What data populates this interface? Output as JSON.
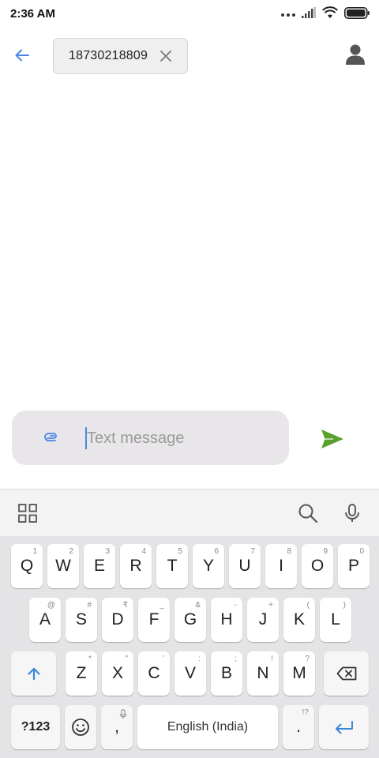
{
  "status_bar": {
    "time": "2:36 AM"
  },
  "header": {
    "recipient": "18730218809"
  },
  "compose": {
    "placeholder": "Text message"
  },
  "colors": {
    "accent": "#4a86e8",
    "send": "#5aa02c",
    "chip_bg": "#efefef",
    "compose_bg": "#e9e6ea",
    "keyboard_bg": "#e4e4e6"
  },
  "keyboard": {
    "row1": [
      {
        "label": "Q",
        "hint": "1"
      },
      {
        "label": "W",
        "hint": "2"
      },
      {
        "label": "E",
        "hint": "3"
      },
      {
        "label": "R",
        "hint": "4"
      },
      {
        "label": "T",
        "hint": "5"
      },
      {
        "label": "Y",
        "hint": "6"
      },
      {
        "label": "U",
        "hint": "7"
      },
      {
        "label": "I",
        "hint": "8"
      },
      {
        "label": "O",
        "hint": "9"
      },
      {
        "label": "P",
        "hint": "0"
      }
    ],
    "row2": [
      {
        "label": "A",
        "hint": "@"
      },
      {
        "label": "S",
        "hint": "#"
      },
      {
        "label": "D",
        "hint": "₹"
      },
      {
        "label": "F",
        "hint": "_"
      },
      {
        "label": "G",
        "hint": "&"
      },
      {
        "label": "H",
        "hint": "-"
      },
      {
        "label": "J",
        "hint": "+"
      },
      {
        "label": "K",
        "hint": "("
      },
      {
        "label": "L",
        "hint": ")"
      }
    ],
    "row3": [
      {
        "label": "Z",
        "hint": "*"
      },
      {
        "label": "X",
        "hint": "\""
      },
      {
        "label": "C",
        "hint": "'"
      },
      {
        "label": "V",
        "hint": ":"
      },
      {
        "label": "B",
        "hint": ";"
      },
      {
        "label": "N",
        "hint": "!"
      },
      {
        "label": "M",
        "hint": "?"
      }
    ],
    "symbols_label": "?123",
    "comma_label": ",",
    "space_label": "English (India)",
    "period_label": ".",
    "period_hint": "!?"
  }
}
